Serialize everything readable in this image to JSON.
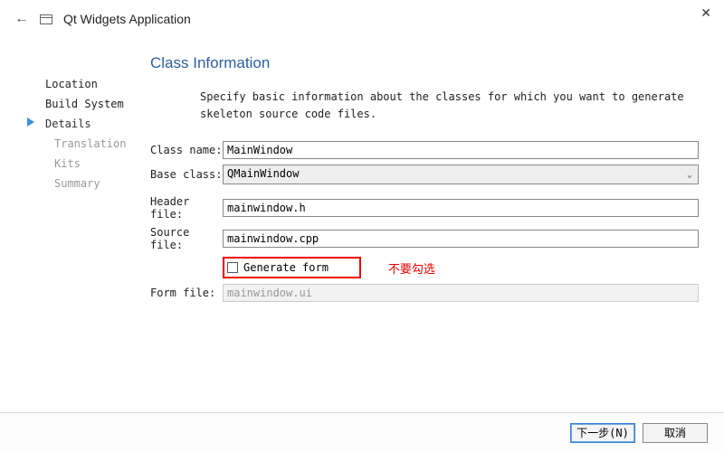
{
  "window": {
    "title": "Qt Widgets Application"
  },
  "sidebar": {
    "items": [
      {
        "label": "Location",
        "state": "done"
      },
      {
        "label": "Build System",
        "state": "done"
      },
      {
        "label": "Details",
        "state": "current"
      },
      {
        "label": "Translation",
        "state": "sub"
      },
      {
        "label": "Kits",
        "state": "sub"
      },
      {
        "label": "Summary",
        "state": "sub"
      }
    ]
  },
  "main": {
    "heading": "Class Information",
    "description": "Specify basic information about the classes for which you want to generate skeleton source code files.",
    "fields": {
      "class_name_label": "Class name:",
      "class_name_value": "MainWindow",
      "base_class_label": "Base class:",
      "base_class_value": "QMainWindow",
      "header_file_label": "Header file:",
      "header_file_value": "mainwindow.h",
      "source_file_label": "Source file:",
      "source_file_value": "mainwindow.cpp",
      "generate_form_label": "Generate form",
      "form_file_label": "Form file:",
      "form_file_value": "mainwindow.ui"
    },
    "annotation": "不要勾选"
  },
  "footer": {
    "next": "下一步(N)",
    "cancel": "取消"
  }
}
